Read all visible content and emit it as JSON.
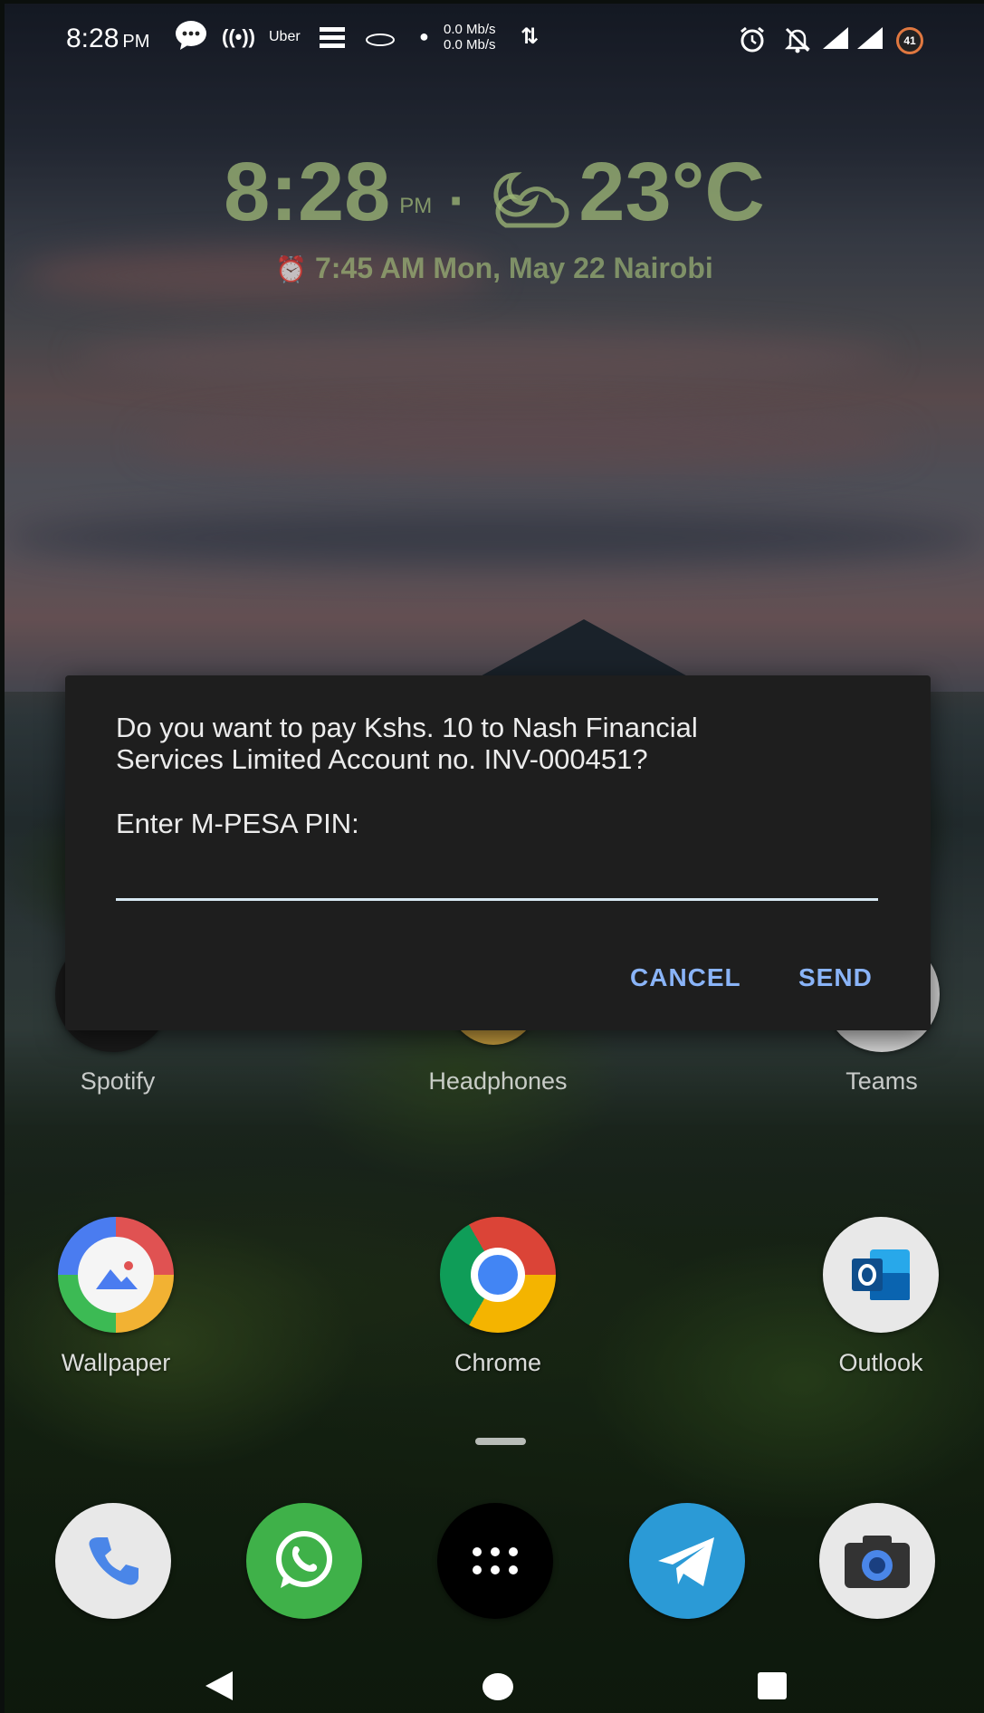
{
  "status_bar": {
    "time": "8:28",
    "ampm": "PM",
    "carrier_label": "Uber",
    "net_up": "0.0 Mb/s",
    "net_down": "0.0 Mb/s",
    "battery": "41",
    "icons": [
      "chat-bubble-icon",
      "hotspot-icon",
      "uber-icon",
      "equal-app-icon",
      "falcon-icon",
      "dot-icon",
      "data-arrows-icon",
      "alarm-icon",
      "notifications-off-icon",
      "signal-icon",
      "signal-icon",
      "battery-icon"
    ]
  },
  "clock_widget": {
    "time": "8:28",
    "ampm": "PM",
    "separator": "·",
    "weather_icon": "partly-cloudy-night-icon",
    "temperature": "23°C",
    "alarm_icon": "alarm-icon",
    "subline": "7:45 AM Mon, May 22 Nairobi"
  },
  "apps_row1": [
    {
      "label": "Spotify"
    },
    {
      "label": "Headphones"
    },
    {
      "label": "Teams"
    }
  ],
  "apps_row2": [
    {
      "label": "Wallpaper",
      "icon": "wallpaper-icon"
    },
    {
      "label": "Chrome",
      "icon": "chrome-icon"
    },
    {
      "label": "Outlook",
      "icon": "outlook-icon"
    }
  ],
  "dock": [
    {
      "icon": "phone-icon"
    },
    {
      "icon": "whatsapp-icon"
    },
    {
      "icon": "app-drawer-icon"
    },
    {
      "icon": "telegram-icon"
    },
    {
      "icon": "camera-icon"
    }
  ],
  "dialog": {
    "message": "Do you want to pay Kshs. 10 to Nash Financial\nServices Limited Account no. INV-000451?",
    "prompt": "Enter M-PESA PIN:",
    "pin_value": "",
    "cancel_label": "CANCEL",
    "send_label": "SEND",
    "accent_color": "#8ab4f8"
  },
  "colors": {
    "dialog_bg": "#1e1e1e",
    "input_underline": "#d7e8f2",
    "widget_text": "#a0b978"
  }
}
